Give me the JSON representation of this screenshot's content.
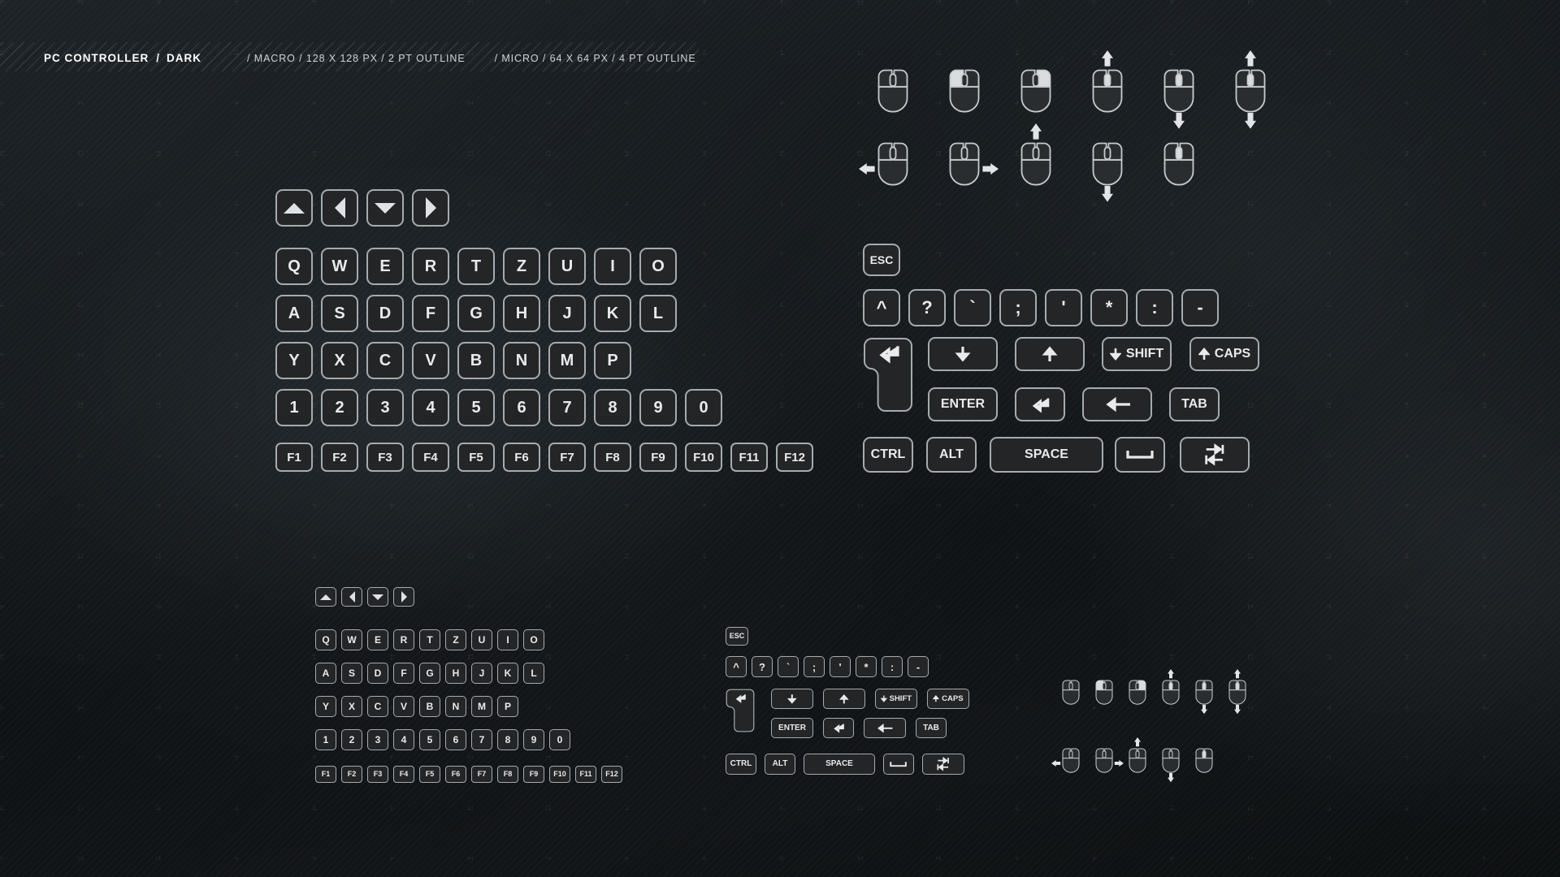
{
  "header": {
    "title": "PC CONTROLLER",
    "separator": "/",
    "theme": "DARK",
    "spec_macro": "/ MACRO / 128 X 128 PX / 2 PT OUTLINE",
    "spec_micro": "/ MICRO / 64 X 64 PX / 4 PT OUTLINE"
  },
  "colors": {
    "key_fill": "#232527",
    "key_border": "#a6abae",
    "key_text": "#e8eaec",
    "background": "#15191c",
    "accent_white": "#ffffff"
  },
  "keyboard": {
    "arrows": [
      {
        "name": "arrow-up-key",
        "icon": "triangle-up"
      },
      {
        "name": "arrow-left-key",
        "icon": "triangle-left"
      },
      {
        "name": "arrow-down-key",
        "icon": "triangle-down"
      },
      {
        "name": "arrow-right-key",
        "icon": "triangle-right"
      }
    ],
    "row_qwertz": [
      "Q",
      "W",
      "E",
      "R",
      "T",
      "Z",
      "U",
      "I",
      "O"
    ],
    "row_asdf": [
      "A",
      "S",
      "D",
      "F",
      "G",
      "H",
      "J",
      "K",
      "L"
    ],
    "row_yxcv": [
      "Y",
      "X",
      "C",
      "V",
      "B",
      "N",
      "M",
      "P"
    ],
    "row_digits": [
      "1",
      "2",
      "3",
      "4",
      "5",
      "6",
      "7",
      "8",
      "9",
      "0"
    ],
    "row_fkeys": [
      "F1",
      "F2",
      "F3",
      "F4",
      "F5",
      "F6",
      "F7",
      "F8",
      "F9",
      "F10",
      "F11",
      "F12"
    ],
    "esc_label": "ESC",
    "row_symbols": [
      "^",
      "?",
      "`",
      ";",
      "'",
      "*",
      ":",
      "-"
    ],
    "special": {
      "enter_tall_icon": "enter-return-arrow",
      "shift_label": "SHIFT",
      "caps_label": "CAPS",
      "enter_label": "ENTER",
      "return_icon": "enter-return-arrow",
      "backspace_icon": "arrow-left-long",
      "tab_label": "TAB",
      "down_icon": "arrow-down",
      "up_icon": "arrow-up",
      "ctrl_label": "CTRL",
      "alt_label": "ALT",
      "space_label": "SPACE",
      "spacebar_icon": "spacebar-glyph",
      "tabswap_icon": "tab-both-arrows"
    }
  },
  "mice": {
    "macro_row1": [
      {
        "name": "mouse-neutral",
        "highlight": "none"
      },
      {
        "name": "mouse-left-click",
        "highlight": "left"
      },
      {
        "name": "mouse-right-click",
        "highlight": "right"
      },
      {
        "name": "mouse-scroll-up",
        "highlight": "wheel",
        "arrow": "up"
      },
      {
        "name": "mouse-scroll-down",
        "highlight": "wheel",
        "arrow": "down"
      },
      {
        "name": "mouse-scroll-updown",
        "highlight": "wheel",
        "arrow": "updown"
      }
    ],
    "macro_row2": [
      {
        "name": "mouse-move-left",
        "highlight": "none",
        "arrow": "left"
      },
      {
        "name": "mouse-move-right",
        "highlight": "none",
        "arrow": "right"
      },
      {
        "name": "mouse-move-up",
        "highlight": "none",
        "arrow": "up"
      },
      {
        "name": "mouse-move-down",
        "highlight": "none",
        "arrow": "down"
      },
      {
        "name": "mouse-wheel-press",
        "highlight": "wheel",
        "arrow": "none"
      }
    ],
    "micro_row1": [
      {
        "name": "mouse-neutral",
        "highlight": "none"
      },
      {
        "name": "mouse-left-click",
        "highlight": "left"
      },
      {
        "name": "mouse-right-click",
        "highlight": "right"
      },
      {
        "name": "mouse-scroll-up",
        "highlight": "wheel",
        "arrow": "up"
      },
      {
        "name": "mouse-scroll-down",
        "highlight": "wheel",
        "arrow": "down"
      },
      {
        "name": "mouse-scroll-updown",
        "highlight": "wheel",
        "arrow": "updown"
      }
    ],
    "micro_row2": [
      {
        "name": "mouse-move-left",
        "highlight": "none",
        "arrow": "left"
      },
      {
        "name": "mouse-move-right",
        "highlight": "none",
        "arrow": "right"
      },
      {
        "name": "mouse-move-up",
        "highlight": "none",
        "arrow": "up"
      },
      {
        "name": "mouse-move-down",
        "highlight": "none",
        "arrow": "down"
      },
      {
        "name": "mouse-wheel-press",
        "highlight": "wheel",
        "arrow": "none"
      }
    ]
  }
}
